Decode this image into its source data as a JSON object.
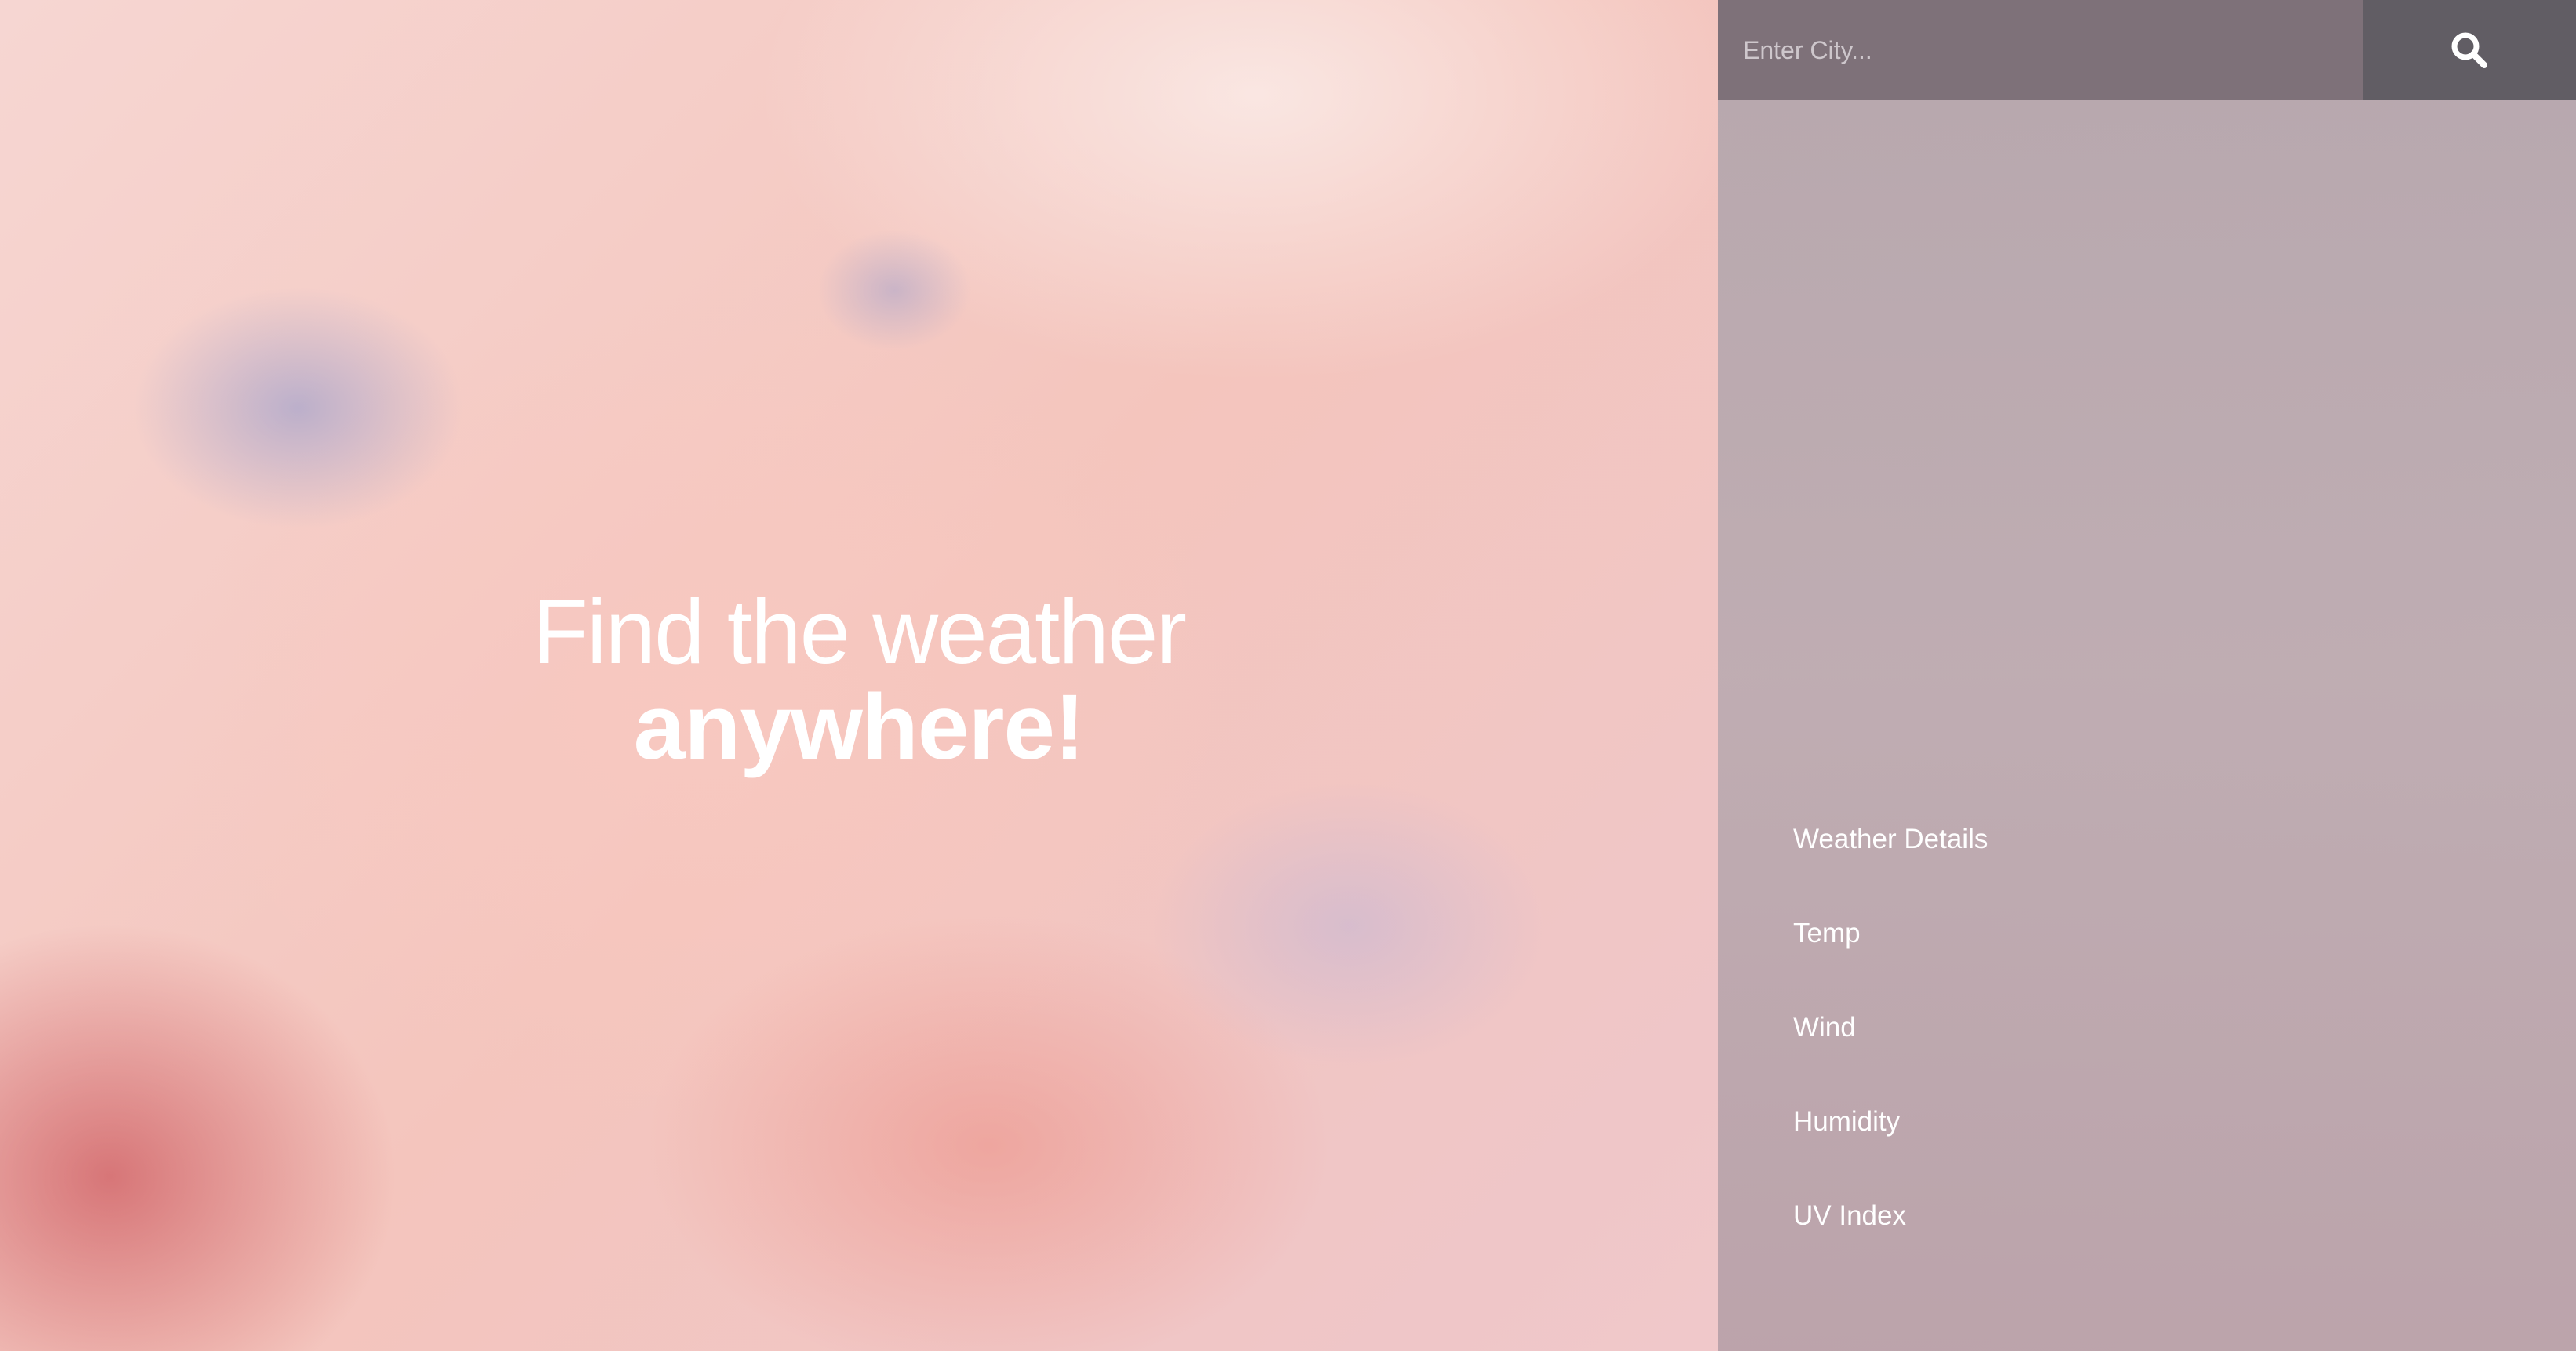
{
  "hero": {
    "line1": "Find the weather",
    "line2": "anywhere!"
  },
  "search": {
    "placeholder": "Enter City...",
    "value": "",
    "icon": "search-icon"
  },
  "details": {
    "title": "Weather Details",
    "rows": [
      {
        "label": "Temp",
        "value": ""
      },
      {
        "label": "Wind",
        "value": ""
      },
      {
        "label": "Humidity",
        "value": ""
      },
      {
        "label": "UV Index",
        "value": ""
      }
    ]
  },
  "colors": {
    "text": "#ffffff",
    "search_input_bg": "#7a6e76",
    "search_button_bg": "#5c5860",
    "panel_bg": "#b8a6ad"
  }
}
